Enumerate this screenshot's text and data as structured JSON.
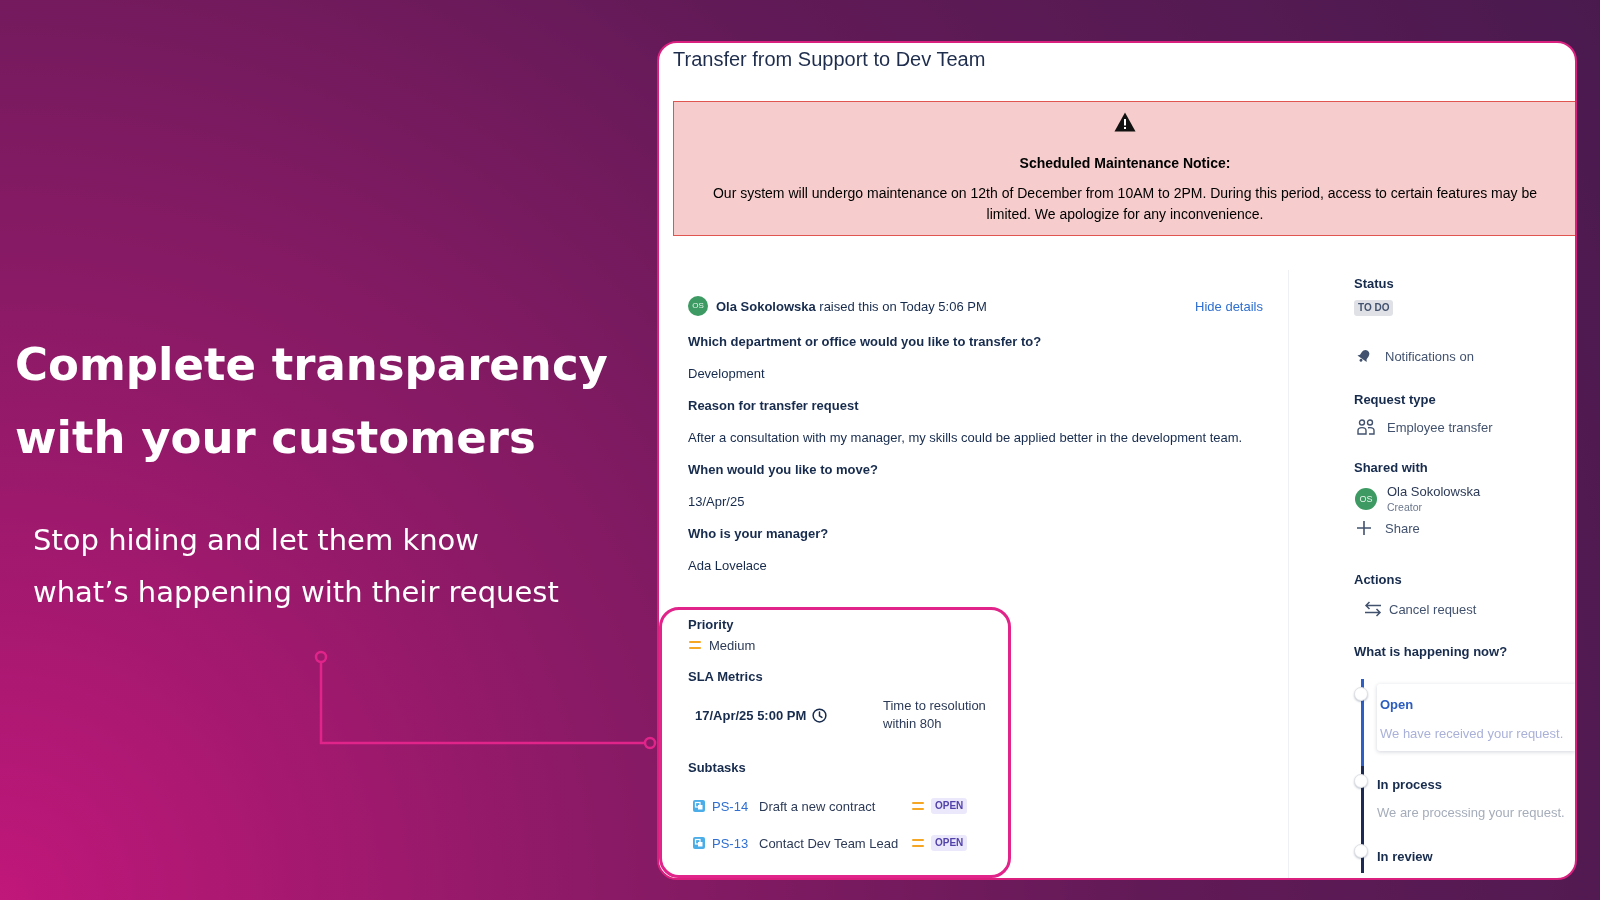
{
  "hero": {
    "heading": "Complete transparency with your customers",
    "subheading": "Stop hiding and let them know what’s happening with their request"
  },
  "request": {
    "title": "Transfer from Support to Dev Team",
    "notice": {
      "heading": "Scheduled Maintenance Notice:",
      "text": "Our system will undergo maintenance on 12th of December from 10AM to 2PM. During this period, access to certain features may be limited. We apologize for any inconvenience."
    },
    "reporter": {
      "initials": "OS",
      "text": "**Ola Sokolowska** raised this on Today 5:06 PM"
    },
    "hide_details": "Hide details",
    "fields": [
      {
        "question": "Which department or office would you like to transfer to?",
        "answer": "Development"
      },
      {
        "question": "Reason for transfer request",
        "answer": "After a consultation with my manager, my skills could be applied better in the development team."
      },
      {
        "question": "When would you like to move?",
        "answer": "13/Apr/25"
      },
      {
        "question": "Who is your manager?",
        "answer": "Ada Lovelace"
      }
    ],
    "priority": {
      "label": "Priority",
      "value": "Medium"
    },
    "sla": {
      "label": "SLA Metrics",
      "due": "17/Apr/25 5:00 PM",
      "goal": "Time to resolution within 80h"
    },
    "subtasks": {
      "label": "Subtasks",
      "items": [
        {
          "key": "PS-14",
          "summary": "Draft a new contract",
          "status": "OPEN"
        },
        {
          "key": "PS-13",
          "summary": "Contact Dev Team Lead",
          "status": "OPEN"
        }
      ]
    }
  },
  "sidebar": {
    "status": {
      "label": "Status",
      "value": "TO DO"
    },
    "notifications": "Notifications on",
    "request_type": {
      "label": "Request type",
      "value": "Employee transfer"
    },
    "shared_with": {
      "label": "Shared with",
      "people": [
        {
          "initials": "OS",
          "name": "Ola Sokolowska",
          "role": "Creator"
        }
      ],
      "share": "Share"
    },
    "actions": {
      "label": "Actions",
      "items": [
        "Cancel request"
      ]
    },
    "progress": {
      "label": "What is happening now?",
      "steps": [
        {
          "title": "Open",
          "description": "We have received your request.",
          "selected": true
        },
        {
          "title": "In process",
          "description": "We are processing your request.",
          "selected": false
        },
        {
          "title": "In review",
          "selected": false
        }
      ]
    }
  }
}
